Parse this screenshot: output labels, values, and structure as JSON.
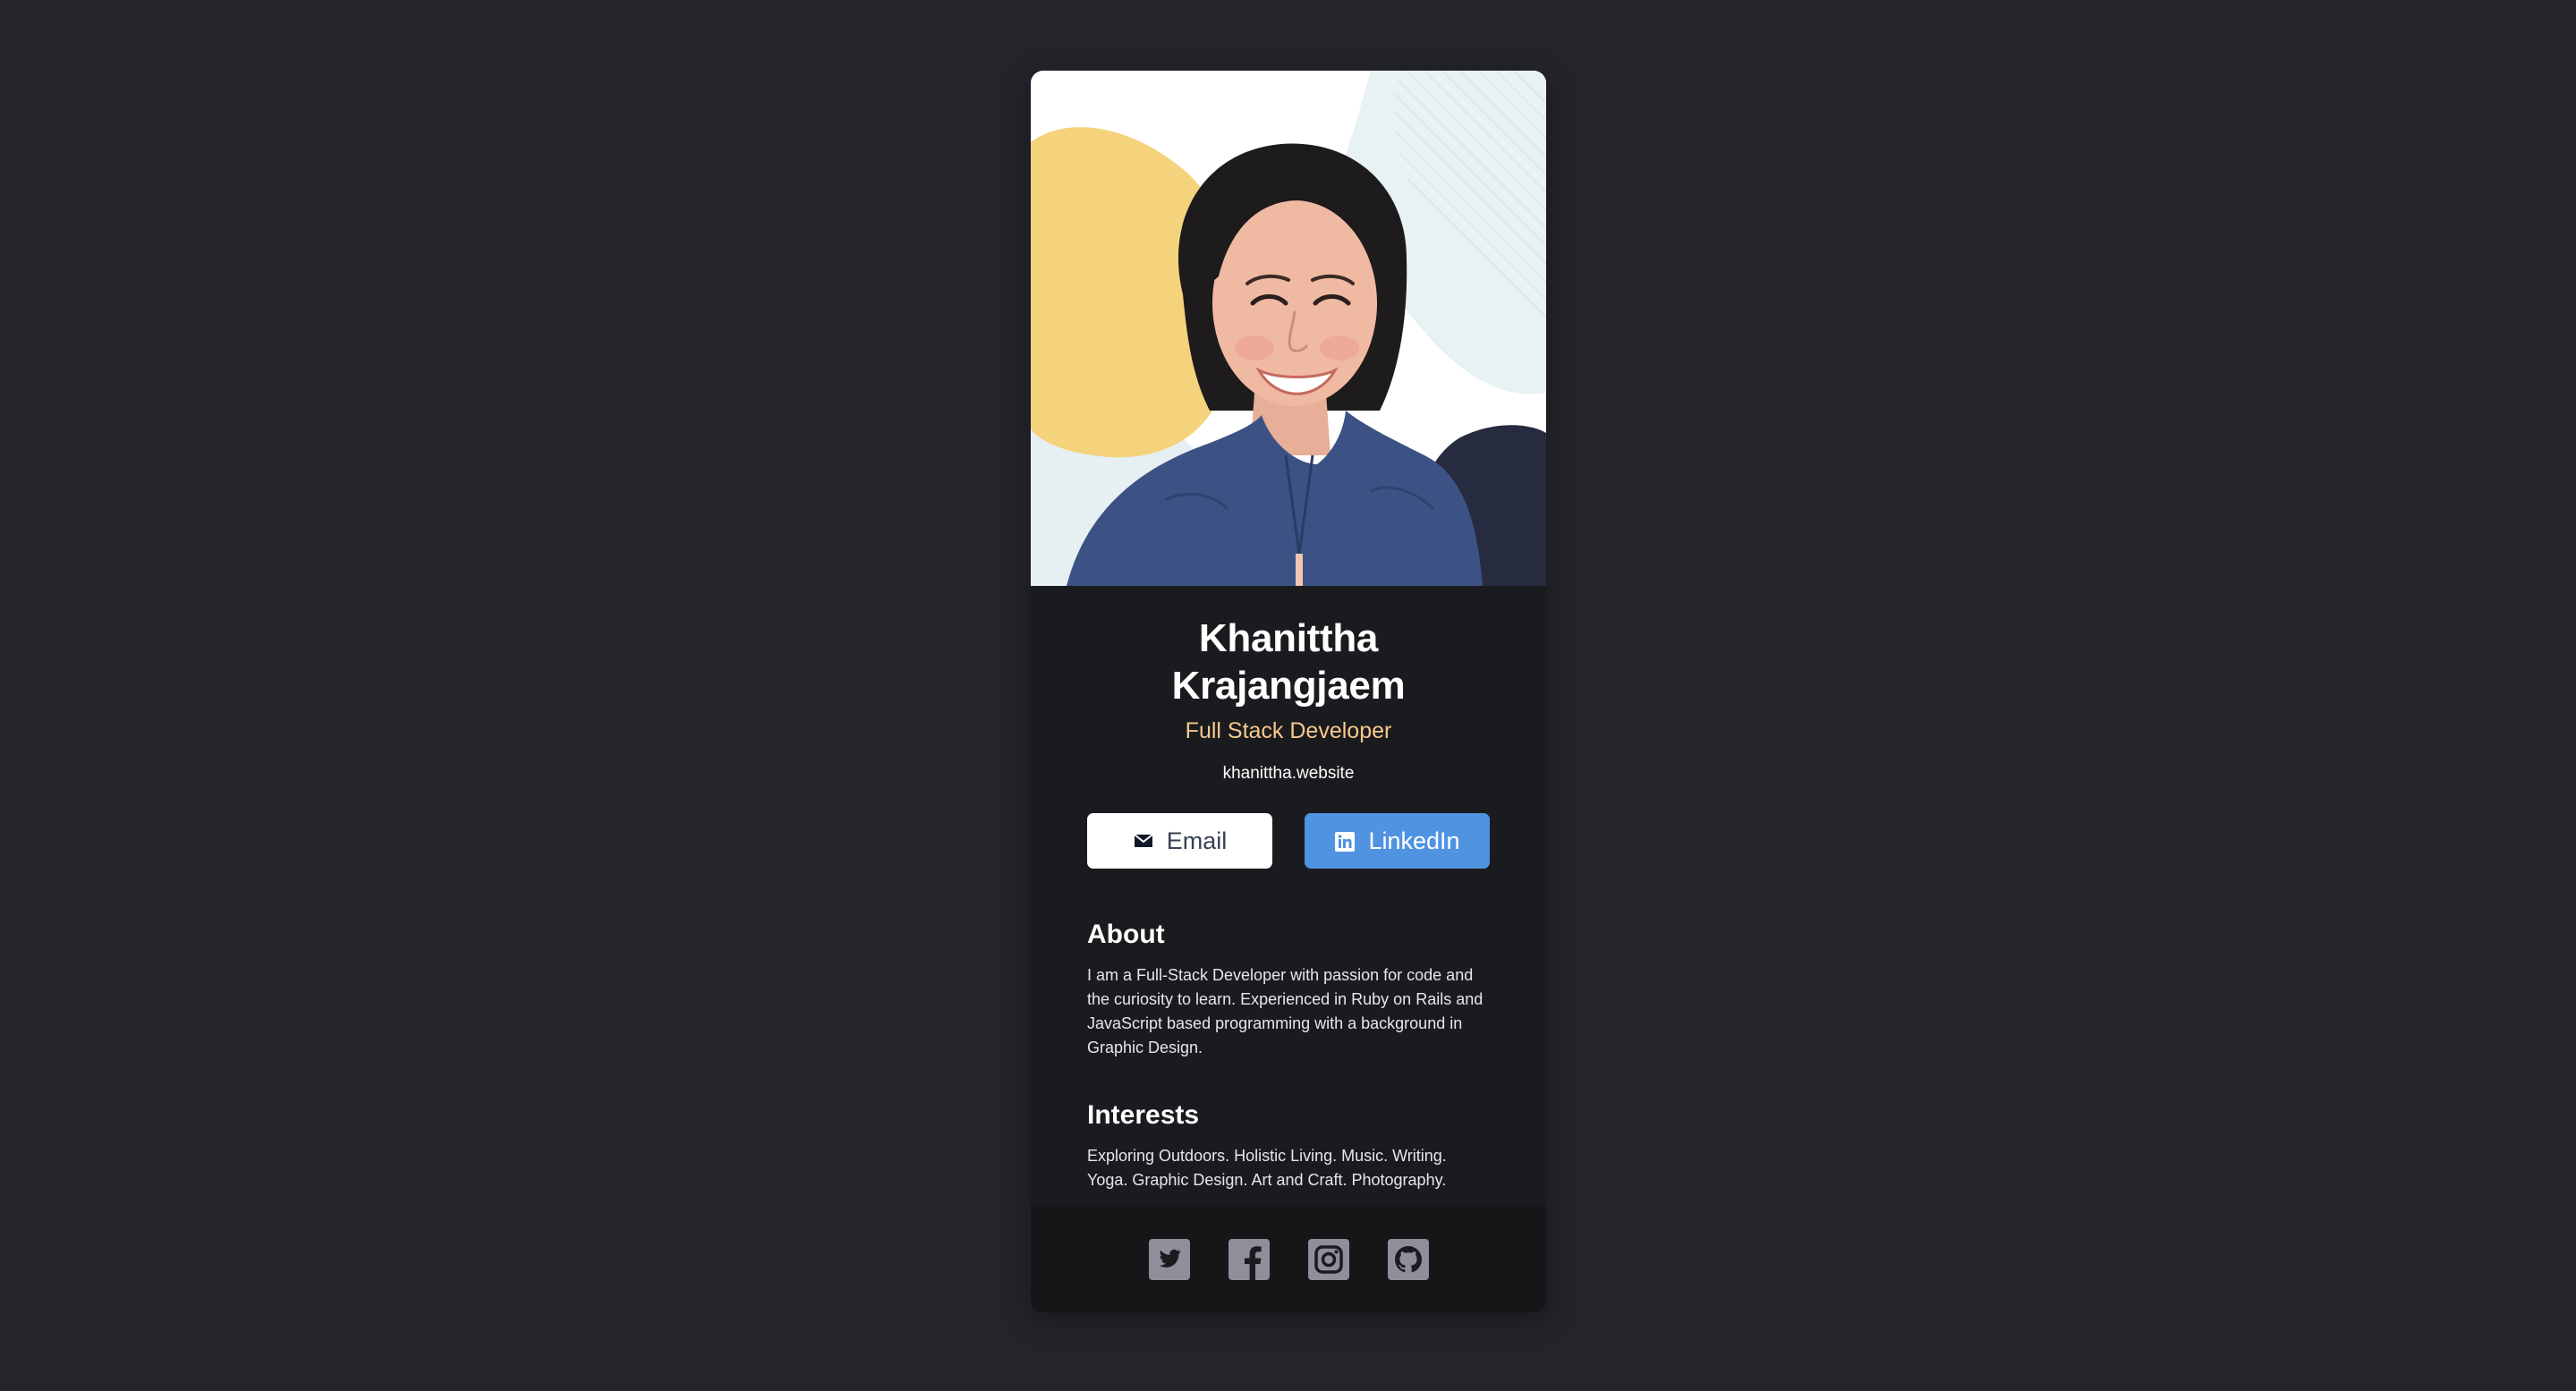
{
  "profile": {
    "name": "Khanittha Krajangjaem",
    "role": "Full Stack Developer",
    "website": "khanittha.website"
  },
  "buttons": {
    "email_label": "Email",
    "email_icon": "envelope-icon",
    "linkedin_label": "LinkedIn",
    "linkedin_icon": "linkedin-icon"
  },
  "about": {
    "title": "About",
    "text": "I am a Full-Stack Developer with passion for code and the curiosity to learn. Experienced in Ruby on Rails and JavaScript based programming with a background in Graphic Design."
  },
  "interests": {
    "title": "Interests",
    "text": "Exploring Outdoors. Holistic Living. Music. Writing. Yoga. Graphic Design. Art and Craft. Photography."
  },
  "footer": {
    "social_icons": [
      "twitter-icon",
      "facebook-icon",
      "instagram-icon",
      "github-icon"
    ]
  },
  "colors": {
    "page_background": "#23252b",
    "card_background": "#1a1b1e",
    "footer_background": "#161619",
    "role_accent": "#f7c98e",
    "linkedin_button": "#5093e1",
    "email_button": "#ffffff",
    "social_icon": "#918e9b"
  }
}
